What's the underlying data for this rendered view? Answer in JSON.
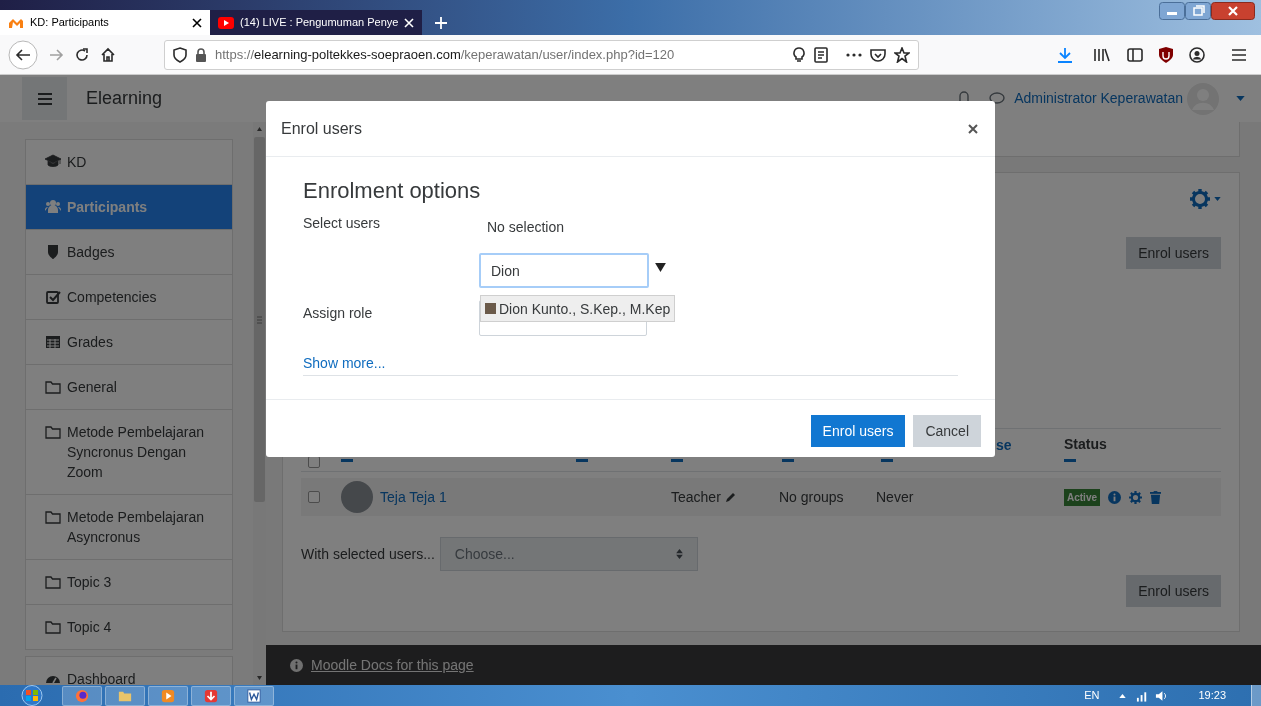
{
  "browser_tabs": [
    {
      "kind": "moodle",
      "title": "KD: Participants",
      "selected": true
    },
    {
      "kind": "video",
      "title": "(14) LIVE : Pengumuman Penye",
      "selected": false
    }
  ],
  "url": {
    "scheme": "https://",
    "host": "elearning-poltekkes-soepraoen.com",
    "path": "/keperawatan/user/index.php?id=120"
  },
  "site_name": "Elearning",
  "user_name": "Administrator Keperawatan",
  "sidebar": {
    "items": [
      {
        "kind": "cap",
        "label": "KD",
        "selected": false
      },
      {
        "kind": "users",
        "label": "Participants",
        "selected": true
      },
      {
        "kind": "shield",
        "label": "Badges",
        "selected": false
      },
      {
        "kind": "check",
        "label": "Competencies",
        "selected": false
      },
      {
        "kind": "table",
        "label": "Grades",
        "selected": false
      },
      {
        "kind": "folder",
        "label": "General",
        "selected": false
      },
      {
        "kind": "folder",
        "label": "Metode Pembelajaran Syncronus Dengan Zoom",
        "selected": false
      },
      {
        "kind": "folder",
        "label": "Metode Pembelajaran Asyncronus",
        "selected": false
      },
      {
        "kind": "folder",
        "label": "Topic 3",
        "selected": false
      },
      {
        "kind": "folder",
        "label": "Topic 4",
        "selected": false
      }
    ],
    "extra_items": [
      {
        "kind": "dashboard",
        "label": "Dashboard",
        "selected": false
      }
    ]
  },
  "participants": {
    "top_button": "Enrol users",
    "table": {
      "select_all_checked": false,
      "columns": [
        {
          "label": "se"
        },
        {
          "label": "Status"
        }
      ],
      "rows": [
        {
          "checked": false,
          "name": "Teja Teja 1",
          "role": "Teacher",
          "groups": "No groups",
          "last_access": "Never",
          "status": "Active"
        }
      ]
    },
    "bulk_label": "With selected users...",
    "bulk_select": {
      "placeholder": "Choose..."
    },
    "bottom_button": "Enrol users"
  },
  "modal": {
    "title": "Enrol users",
    "heading": "Enrolment options",
    "select_users_label": "Select users",
    "selection": "No selection",
    "search": {
      "value": "Dion"
    },
    "suggestions": [
      "Dion Kunto., S.Kep., M.Kep"
    ],
    "assign_role_label": "Assign role",
    "show_more": "Show more...",
    "buttons": [
      {
        "kind": "primary",
        "label": "Enrol users"
      },
      {
        "kind": "secondary",
        "label": "Cancel"
      }
    ]
  },
  "footer_link": "Moodle Docs for this page",
  "taskbar": {
    "language": "EN",
    "time": "19:23"
  }
}
